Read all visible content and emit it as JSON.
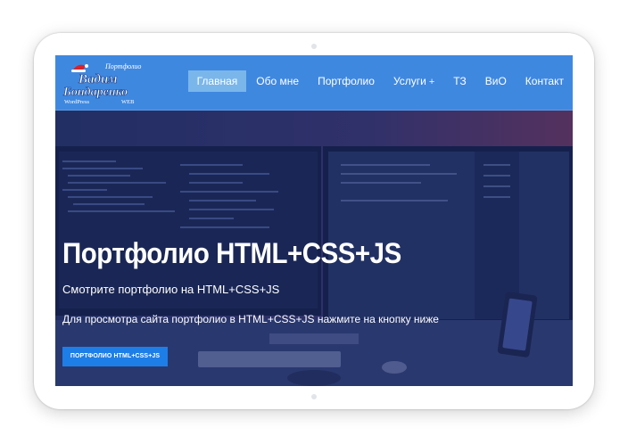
{
  "logo": {
    "top": "Портфолио",
    "name_line1": "Вадим",
    "name_line2": "Бондаренко",
    "bottom_left": "WordPress",
    "bottom_right": "WEB"
  },
  "nav": {
    "items": [
      {
        "label": "Главная",
        "active": true
      },
      {
        "label": "Обо мне"
      },
      {
        "label": "Портфолио"
      },
      {
        "label": "Услуги",
        "suffix": "+"
      },
      {
        "label": "ТЗ"
      },
      {
        "label": "ВиО"
      },
      {
        "label": "Контакт"
      }
    ]
  },
  "hero": {
    "title": "Портфолио HTML+CSS+JS",
    "subtitle": "Смотрите портфолио на HTML+CSS+JS",
    "description": "Для просмотра сайта портфолио в HTML+CSS+JS нажмите на кнопку ниже",
    "button_label": "ПОРТФОЛИО HTML+CSS+JS"
  },
  "colors": {
    "nav_bg": "#3f88e0",
    "nav_active": "#7ab6ea",
    "button": "#1e7ee8",
    "overlay": "#1c2a70"
  }
}
